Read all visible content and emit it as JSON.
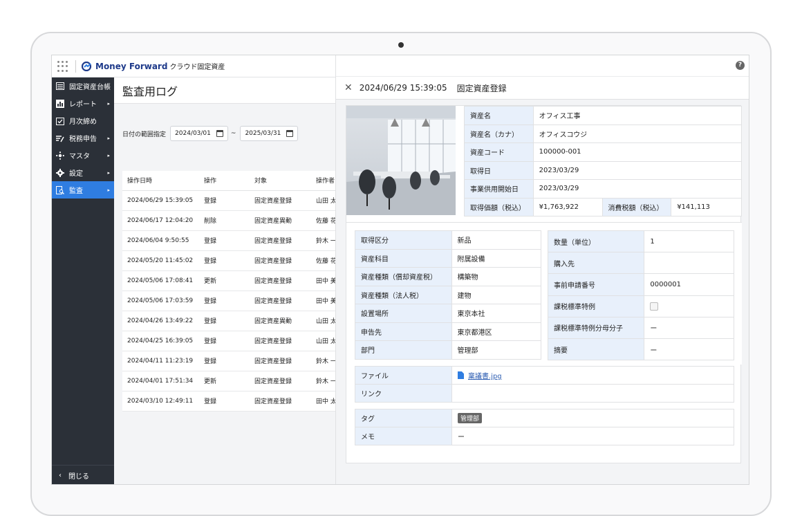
{
  "app": {
    "logo_text": "Money Forward",
    "logo_sub": "クラウド固定資産"
  },
  "sidebar": {
    "items": [
      {
        "label": "固定資産台帳",
        "icon": "ledger-icon",
        "arrow": false
      },
      {
        "label": "レポート",
        "icon": "chart-icon",
        "arrow": true
      },
      {
        "label": "月次締め",
        "icon": "checkbox-icon",
        "arrow": false
      },
      {
        "label": "税務申告",
        "icon": "tax-icon",
        "arrow": true
      },
      {
        "label": "マスタ",
        "icon": "master-icon",
        "arrow": true
      },
      {
        "label": "設定",
        "icon": "gear-icon",
        "arrow": true
      },
      {
        "label": "監査",
        "icon": "audit-icon",
        "arrow": true,
        "active": true
      }
    ],
    "close_label": "閉じる"
  },
  "main": {
    "title": "監査用ログ",
    "filter": {
      "label": "日付の範囲指定",
      "start": "2024/03/01",
      "end": "2025/03/31",
      "separator": "~"
    },
    "table": {
      "headers": [
        "操作日時",
        "操作",
        "対象",
        "操作者"
      ],
      "rows": [
        [
          "2024/06/29 15:39:05",
          "登録",
          "固定資産登録",
          "山田 太"
        ],
        [
          "2024/06/17 12:04:20",
          "削除",
          "固定資産異動",
          "佐藤 花"
        ],
        [
          "2024/06/04 9:50:55",
          "登録",
          "固定資産登録",
          "鈴木 一"
        ],
        [
          "2024/05/20 11:45:02",
          "登録",
          "固定資産登録",
          "佐藤 花"
        ],
        [
          "2024/05/06 17:08:41",
          "更新",
          "固定資産登録",
          "田中 美"
        ],
        [
          "2024/05/06 17:03:59",
          "登録",
          "固定資産登録",
          "田中 美"
        ],
        [
          "2024/04/26 13:49:22",
          "登録",
          "固定資産異動",
          "山田 太"
        ],
        [
          "2024/04/25 16:39:05",
          "登録",
          "固定資産登録",
          "山田 太"
        ],
        [
          "2024/04/11 11:23:19",
          "登録",
          "固定資産登録",
          "鈴木 一"
        ],
        [
          "2024/04/01 17:51:34",
          "更新",
          "固定資産登録",
          "鈴木 一"
        ],
        [
          "2024/03/10 12:49:11",
          "登録",
          "固定資産登録",
          "田中 太"
        ]
      ]
    }
  },
  "panel": {
    "timestamp": "2024/06/29 15:39:05",
    "title": "固定資産登録",
    "basic": [
      {
        "label": "資産名",
        "value": "オフィス工事"
      },
      {
        "label": "資産名（カナ）",
        "value": "オフィスコウジ"
      },
      {
        "label": "資産コード",
        "value": "100000-001"
      },
      {
        "label": "取得日",
        "value": "2023/03/29"
      },
      {
        "label": "事業供用開始日",
        "value": "2023/03/29"
      }
    ],
    "price": {
      "label": "取得価額（税込）",
      "value": "¥1,763,922",
      "tax_label": "消費税額（税込）",
      "tax_value": "¥141,113"
    },
    "left_details": [
      {
        "label": "取得区分",
        "value": "新品"
      },
      {
        "label": "資産科目",
        "value": "附属設備"
      },
      {
        "label": "資産種類（償却資産税）",
        "value": "構築物"
      },
      {
        "label": "資産種類（法人税）",
        "value": "建物"
      },
      {
        "label": "設置場所",
        "value": "東京本社"
      },
      {
        "label": "申告先",
        "value": "東京都港区"
      },
      {
        "label": "部門",
        "value": "管理部"
      }
    ],
    "right_details": [
      {
        "label": "数量（単位）",
        "value": "1"
      },
      {
        "label": "購入先",
        "value": ""
      },
      {
        "label": "事前申請番号",
        "value": "0000001"
      },
      {
        "label": "課税標準特例",
        "value": ""
      },
      {
        "label": "課税標準特例分母分子",
        "value": "ー"
      },
      {
        "label": "摘要",
        "value": "ー"
      }
    ],
    "file": {
      "label": "ファイル",
      "value": "稟議書.jpg"
    },
    "link": {
      "label": "リンク",
      "value": ""
    },
    "tag": {
      "label": "タグ",
      "value": "管理部"
    },
    "memo": {
      "label": "メモ",
      "value": "ー"
    }
  },
  "colors": {
    "sidebar_bg": "#2b3038",
    "active_blue": "#2f7de1",
    "label_bg": "#e8f0fb"
  }
}
